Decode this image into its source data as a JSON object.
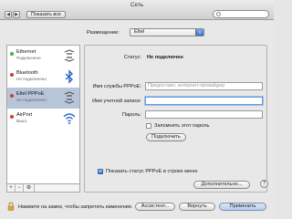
{
  "window": {
    "title": "Сеть"
  },
  "toolbar": {
    "back": "◀",
    "forward": "▶",
    "show_all_label": "Показать все",
    "search_placeholder": ""
  },
  "location": {
    "label": "Размещение:",
    "value": "Eltel"
  },
  "services": [
    {
      "name": "Ethernet",
      "status": "Подключено",
      "status_color": "#3fb33f",
      "icon": "ethernet-icon"
    },
    {
      "name": "Bluetooth",
      "status": "Не подключено",
      "status_color": "#d23b2f",
      "icon": "bluetooth-icon"
    },
    {
      "name": "Eltel PPPoE",
      "status": "Не подключено",
      "status_color": "#d23b2f",
      "icon": "pppoe-icon"
    },
    {
      "name": "AirPort",
      "status": "Выкл.",
      "status_color": "#d23b2f",
      "icon": "airport-icon"
    }
  ],
  "sidebar_buttons": {
    "add": "+",
    "remove": "−",
    "action": "⚙"
  },
  "detail": {
    "status_label": "Статус:",
    "status_value": "Не подключен",
    "service_name_label": "Имя службы PPPoE:",
    "service_name_placeholder": "Предоставл. интернет-провайдер",
    "account_label": "Имя учетной записи:",
    "account_value": "",
    "password_label": "Пароль:",
    "password_value": "",
    "remember_label": "Запомнить этот пароль",
    "connect_button": "Подключить",
    "show_status_label": "Показать статус PPPoE в строке меню",
    "advanced_button": "Дополнительно...",
    "help_button": "?"
  },
  "footer": {
    "lock_text": "Нажмите на замок, чтобы запретить изменения.",
    "assistant_button": "Ассистент...",
    "revert_button": "Вернуть",
    "apply_button": "Применить"
  }
}
